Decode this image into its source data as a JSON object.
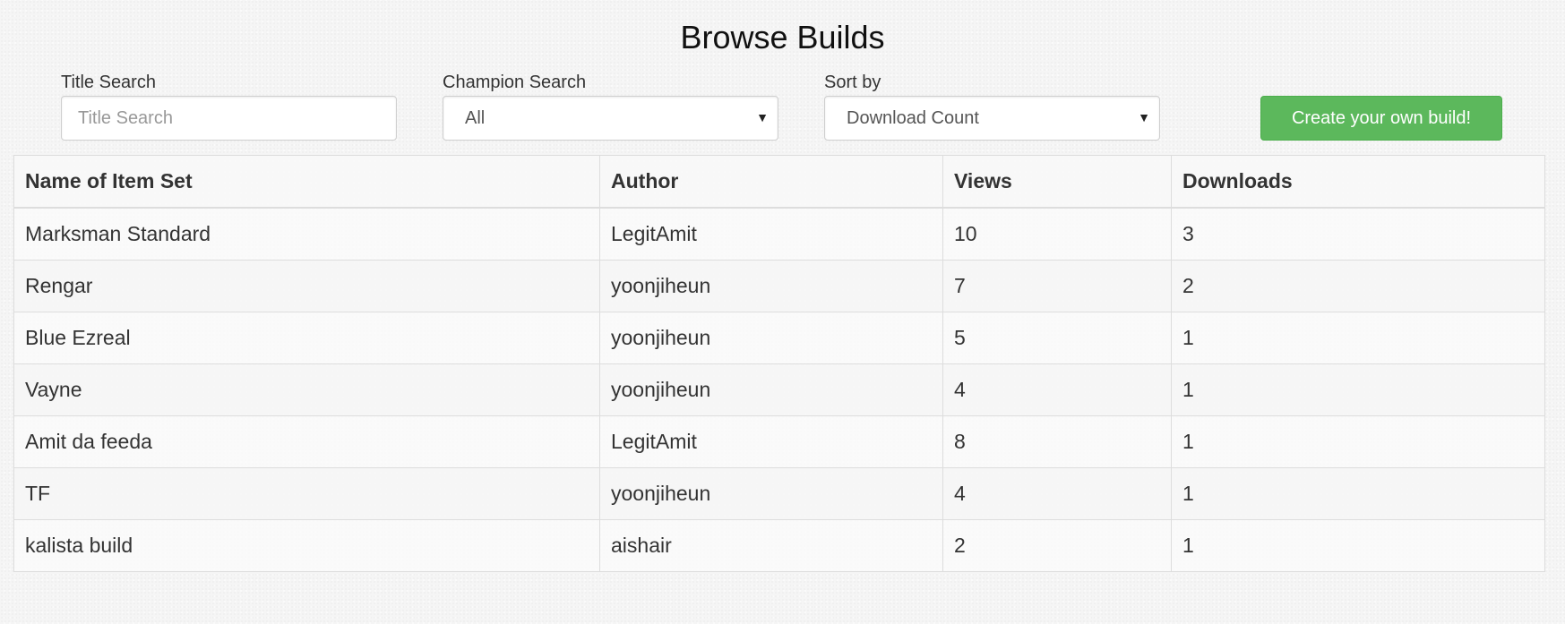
{
  "page": {
    "title": "Browse Builds"
  },
  "filters": {
    "title_search": {
      "label": "Title Search",
      "placeholder": "Title Search",
      "value": ""
    },
    "champion_search": {
      "label": "Champion Search",
      "selected": "All"
    },
    "sort_by": {
      "label": "Sort by",
      "selected": "Download Count"
    }
  },
  "actions": {
    "create_label": "Create your own build!",
    "create_color": "#5cb85c"
  },
  "table": {
    "headers": [
      "Name of Item Set",
      "Author",
      "Views",
      "Downloads"
    ],
    "rows": [
      [
        "Marksman Standard",
        "LegitAmit",
        "10",
        "3"
      ],
      [
        "Rengar",
        "yoonjiheun",
        "7",
        "2"
      ],
      [
        "Blue Ezreal",
        "yoonjiheun",
        "5",
        "1"
      ],
      [
        "Vayne",
        "yoonjiheun",
        "4",
        "1"
      ],
      [
        "Amit da feeda",
        "LegitAmit",
        "8",
        "1"
      ],
      [
        "TF",
        "yoonjiheun",
        "4",
        "1"
      ],
      [
        "kalista build",
        "aishair",
        "2",
        "1"
      ]
    ]
  },
  "icons": {
    "select_caret": "caret-down-icon"
  }
}
